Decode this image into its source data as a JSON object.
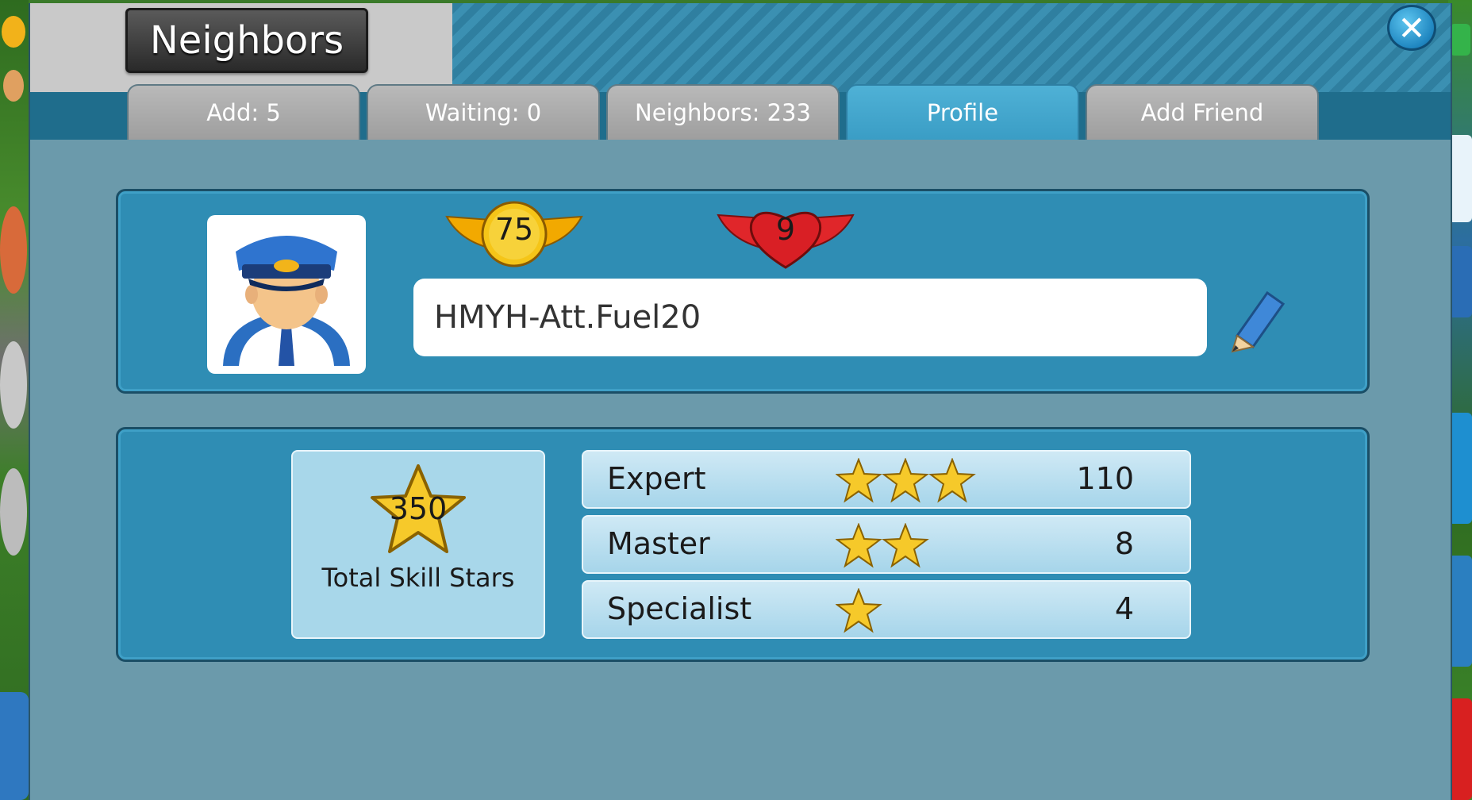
{
  "dialog": {
    "title": "Neighbors",
    "close_icon": "close-icon"
  },
  "tabs": [
    {
      "label": "Add: 5",
      "active": false
    },
    {
      "label": "Waiting: 0",
      "active": false
    },
    {
      "label": "Neighbors: 233",
      "active": false
    },
    {
      "label": "Profile",
      "active": true
    },
    {
      "label": "Add Friend",
      "active": false
    }
  ],
  "profile": {
    "avatar": "pilot-avatar-icon",
    "level": "75",
    "hearts": "9",
    "name": "HMYH-Att.Fuel20",
    "edit_icon": "pencil-icon"
  },
  "skills": {
    "total_value": "350",
    "total_label": "Total Skill Stars",
    "ranks": [
      {
        "name": "Expert",
        "stars": 3,
        "count": "110"
      },
      {
        "name": "Master",
        "stars": 2,
        "count": "8"
      },
      {
        "name": "Specialist",
        "stars": 1,
        "count": "4"
      }
    ]
  },
  "colors": {
    "accent": "#3a9dc5",
    "panel": "#2f8db4",
    "dialog_bg": "#6b9aab",
    "star": "#f4c430"
  }
}
